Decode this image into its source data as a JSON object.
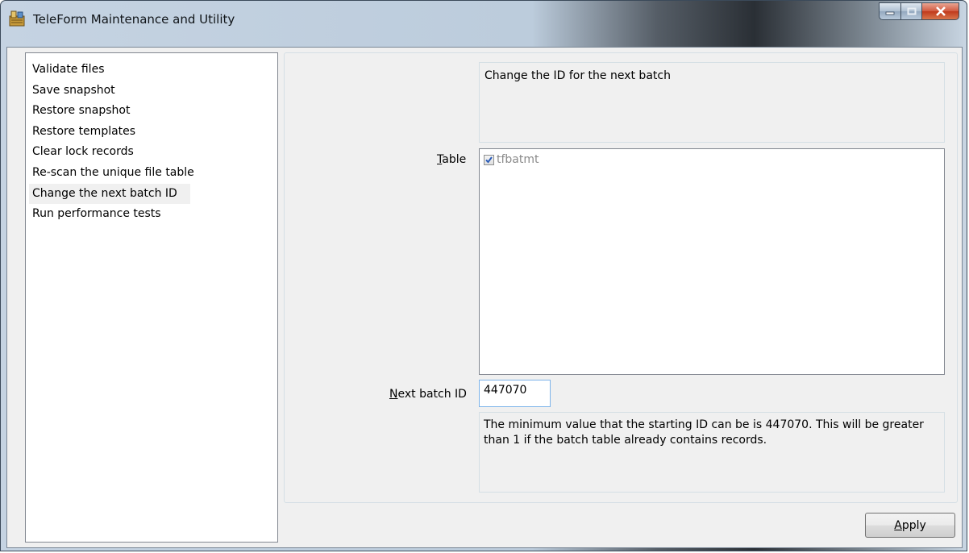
{
  "window": {
    "title": "TeleForm Maintenance and Utility",
    "controls": {
      "minimize": "minimize",
      "maximize": "maximize",
      "close": "X"
    }
  },
  "operations": [
    "Validate files",
    "Save snapshot",
    "Restore snapshot",
    "Restore templates",
    "Clear lock records",
    "Re-scan the unique file table",
    "Change the next batch ID",
    "Run performance tests"
  ],
  "selected_operation_index": 6,
  "panel": {
    "description": "Change the ID for the next batch",
    "table_label_prefix": "T",
    "table_label_rest": "able",
    "table_items": [
      {
        "name": "tfbatmt",
        "checked": true
      }
    ],
    "next_batch_label_prefix": "N",
    "next_batch_label_rest": "ext batch ID",
    "next_batch_value": "447070",
    "info_text": "The minimum value that the starting ID can be is 447070.  This will be greater than 1 if the batch table already contains records."
  },
  "apply_prefix": "A",
  "apply_rest": "pply",
  "icons": {
    "app": "teleform-app-icon",
    "check": "checkmark-icon"
  },
  "colors": {
    "selection_bg": "#f0f0f0",
    "disabled_text": "#8a8a8a",
    "close_button": "#c7402a"
  }
}
